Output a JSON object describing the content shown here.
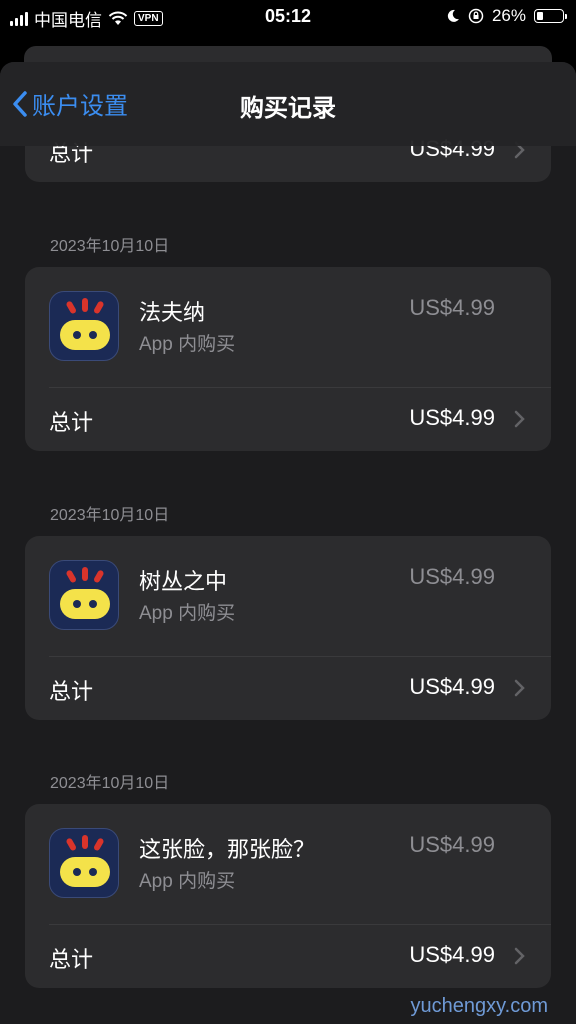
{
  "status": {
    "carrier": "中国电信",
    "vpn": "VPN",
    "time": "05:12",
    "battery": "26%",
    "battery_level": 0.26
  },
  "nav": {
    "back_label": "账户设置",
    "title": "购买记录"
  },
  "total_label": "总计",
  "purchases": [
    {
      "date": "",
      "total": "US$4.99"
    },
    {
      "date": "2023年10月10日",
      "name": "法夫纳",
      "sub": "App 内购买",
      "price": "US$4.99",
      "total": "US$4.99"
    },
    {
      "date": "2023年10月10日",
      "name": "树丛之中",
      "sub": "App 内购买",
      "price": "US$4.99",
      "total": "US$4.99"
    },
    {
      "date": "2023年10月10日",
      "name": "这张脸，那张脸？",
      "sub": "App 内购买",
      "price": "US$4.99",
      "total": "US$4.99"
    }
  ],
  "watermark": "yuchengxy.com",
  "colors": {
    "accent": "#3b8df0",
    "icon_bg": "#1b2a55",
    "icon_face": "#f4e24a",
    "icon_spikes": "#d9342b"
  }
}
